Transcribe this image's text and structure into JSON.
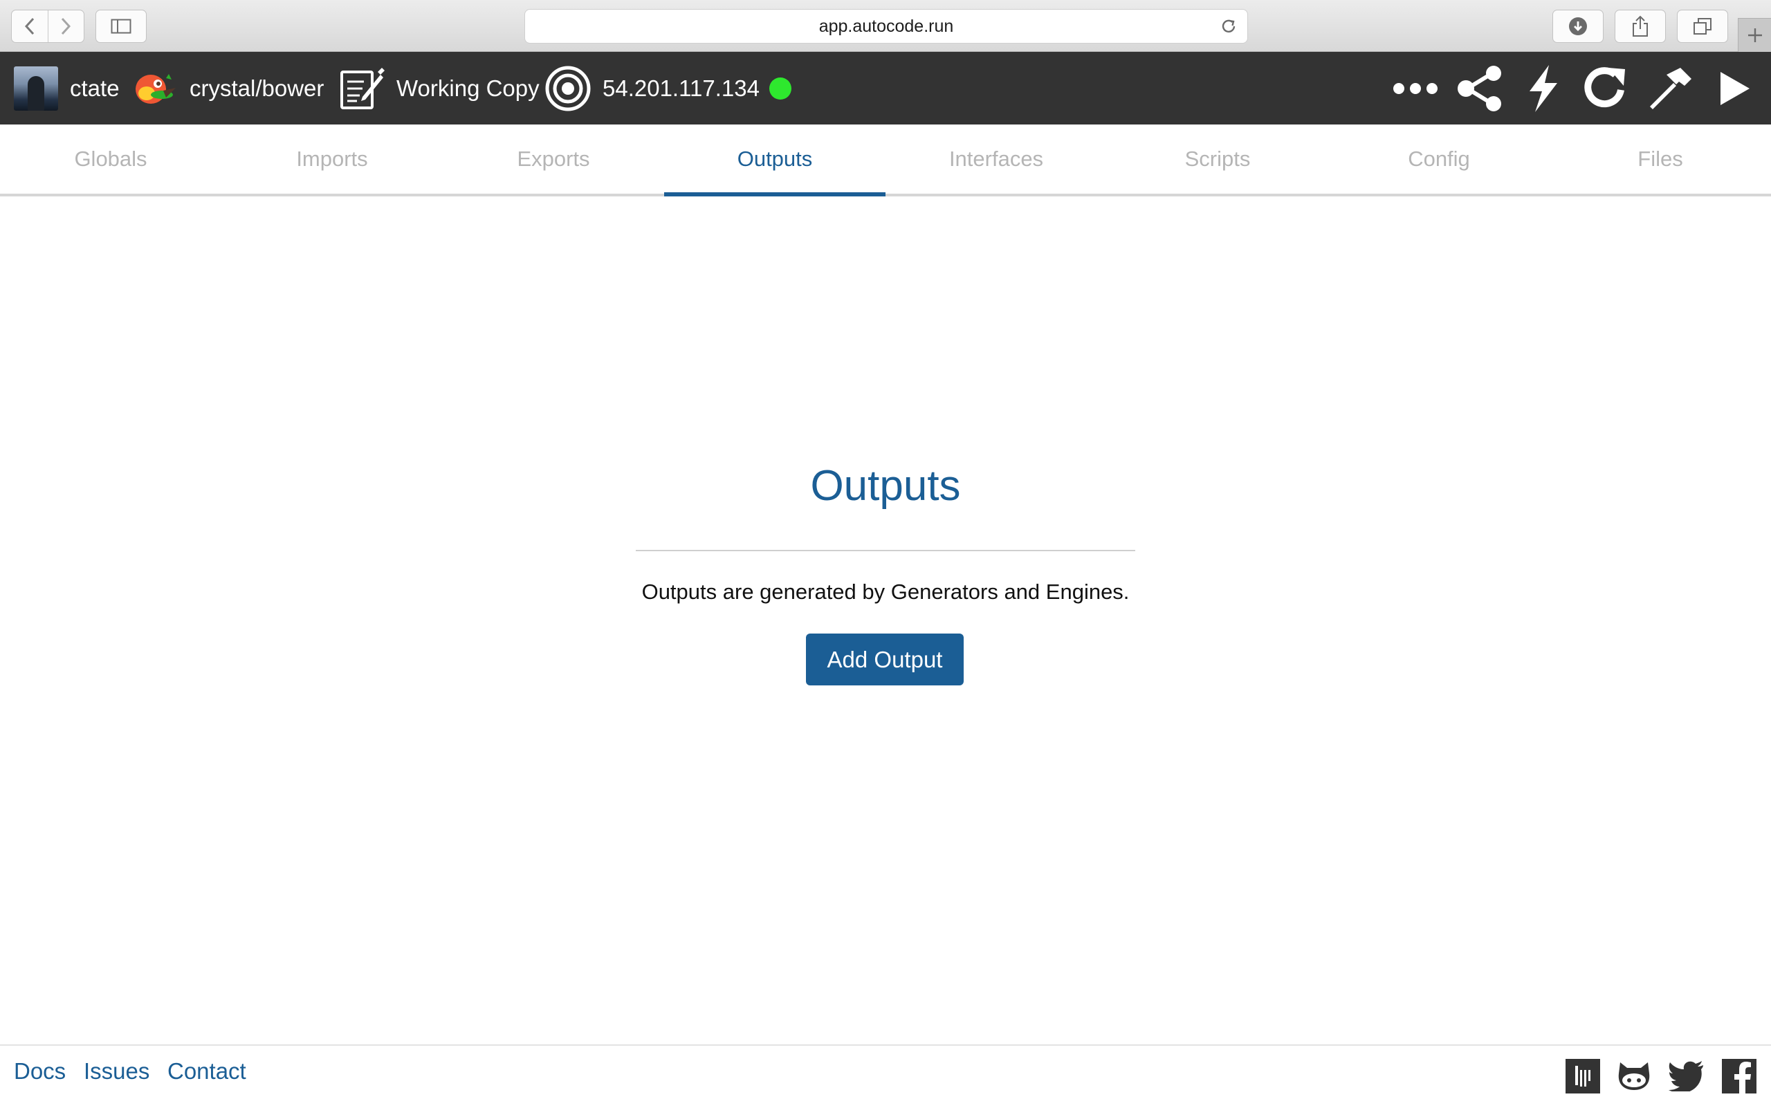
{
  "browser": {
    "url": "app.autocode.run",
    "icons": [
      "back-arrow-icon",
      "forward-arrow-icon",
      "sidebar-icon",
      "reload-icon",
      "download-icon",
      "share-icon",
      "tabs-icon",
      "plus-icon"
    ]
  },
  "header": {
    "username": "ctate",
    "repo": "crystal/bower",
    "branch": "Working Copy",
    "ip_address": "54.201.117.134",
    "status_color": "#2ee82e",
    "actions": [
      "more-dots-icon",
      "share-nodes-icon",
      "lightning-icon",
      "refresh-icon",
      "hammer-icon",
      "play-icon"
    ]
  },
  "tabs": [
    {
      "label": "Globals",
      "active": false
    },
    {
      "label": "Imports",
      "active": false
    },
    {
      "label": "Exports",
      "active": false
    },
    {
      "label": "Outputs",
      "active": true
    },
    {
      "label": "Interfaces",
      "active": false
    },
    {
      "label": "Scripts",
      "active": false
    },
    {
      "label": "Config",
      "active": false
    },
    {
      "label": "Files",
      "active": false
    }
  ],
  "main": {
    "title": "Outputs",
    "description": "Outputs are generated by Generators and Engines.",
    "add_button": "Add Output"
  },
  "footer": {
    "links": [
      "Docs",
      "Issues",
      "Contact"
    ],
    "social_icons": [
      "gitter-icon",
      "github-icon",
      "twitter-icon",
      "facebook-icon"
    ]
  },
  "colors": {
    "accent": "#1b5e95",
    "header_bg": "#333333",
    "tab_inactive": "#b5b5b5"
  }
}
